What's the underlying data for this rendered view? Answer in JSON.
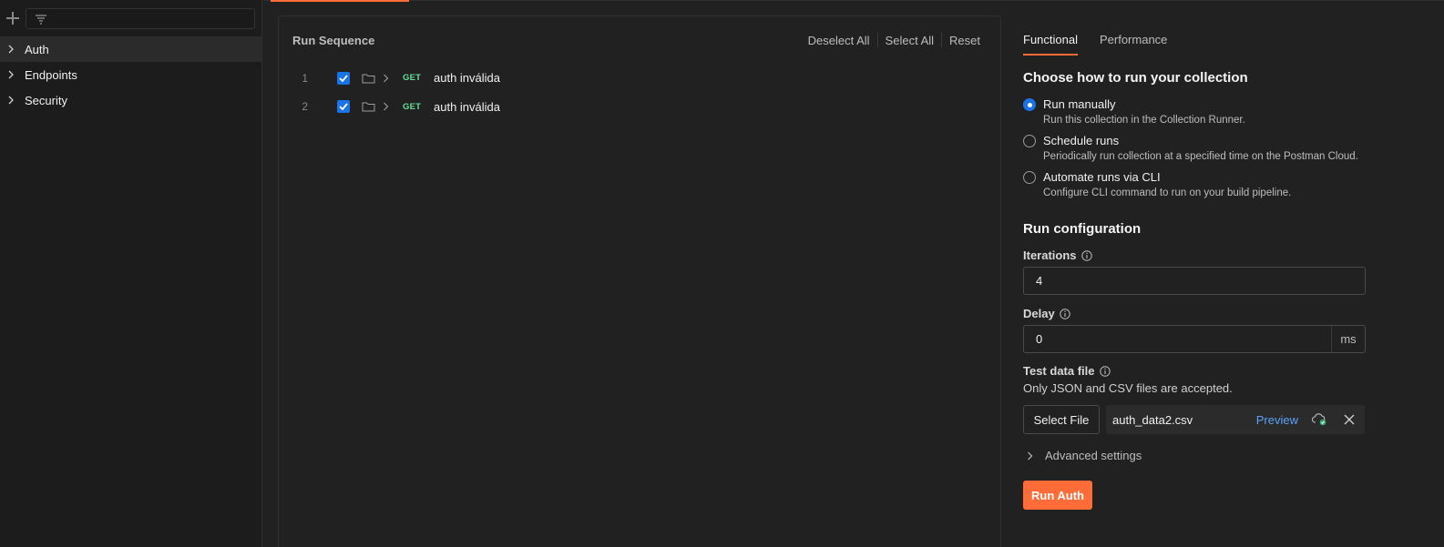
{
  "sidebar": {
    "search": {
      "placeholder": ""
    },
    "items": [
      {
        "label": "Auth"
      },
      {
        "label": "Endpoints"
      },
      {
        "label": "Security"
      }
    ]
  },
  "sequence": {
    "title": "Run Sequence",
    "actions": {
      "deselect_all": "Deselect All",
      "select_all": "Select All",
      "reset": "Reset"
    },
    "rows": [
      {
        "num": "1",
        "method": "GET",
        "name": "auth inválida",
        "checked": true
      },
      {
        "num": "2",
        "method": "GET",
        "name": "auth inválida",
        "checked": true
      }
    ]
  },
  "config": {
    "tabs": [
      {
        "label": "Functional"
      },
      {
        "label": "Performance"
      }
    ],
    "choose_title": "Choose how to run your collection",
    "options": [
      {
        "label": "Run manually",
        "desc": "Run this collection in the Collection Runner.",
        "selected": true
      },
      {
        "label": "Schedule runs",
        "desc": "Periodically run collection at a specified time on the Postman Cloud.",
        "selected": false
      },
      {
        "label": "Automate runs via CLI",
        "desc": "Configure CLI command to run on your build pipeline.",
        "selected": false
      }
    ],
    "run_config_title": "Run configuration",
    "iterations": {
      "label": "Iterations",
      "value": "4"
    },
    "delay": {
      "label": "Delay",
      "value": "0",
      "unit": "ms"
    },
    "test_data": {
      "label": "Test data file",
      "hint": "Only JSON and CSV files are accepted.",
      "select_label": "Select File",
      "file_name": "auth_data2.csv",
      "preview_label": "Preview"
    },
    "advanced_label": "Advanced settings",
    "run_label": "Run Auth"
  },
  "colors": {
    "accent": "#ff6c37",
    "checkbox": "#1b73e8",
    "method_get": "#6bdd9a",
    "link": "#5aa2f7"
  }
}
